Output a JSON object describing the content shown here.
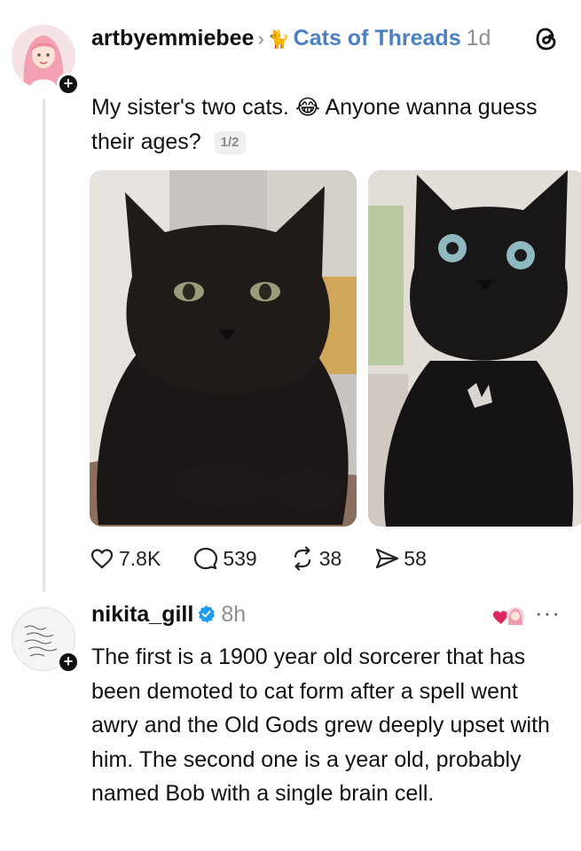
{
  "post": {
    "username": "artbyemmiebee",
    "separator": "›",
    "community_icon": "cat-emoji-icon",
    "community": "Cats of Threads",
    "time": "1d",
    "text_before_emoji": "My sister's two cats.",
    "emoji": "😂",
    "text_after_emoji": " Anyone wanna guess their ages?",
    "page_indicator": "1/2",
    "actions": {
      "likes": "7.8K",
      "comments": "539",
      "reposts": "38",
      "shares": "58"
    }
  },
  "reply": {
    "username": "nikita_gill",
    "time": "8h",
    "text": "The first is a 1900 year old sorcerer that has been demoted to cat form after a spell went awry and the Old Gods grew deeply upset with him. The second one is a year old, probably named Bob with a single brain cell.",
    "more": "···"
  },
  "colors": {
    "community_link": "#4a7fc0",
    "verified": "#1d9bf0",
    "heart": "#e0245e"
  }
}
